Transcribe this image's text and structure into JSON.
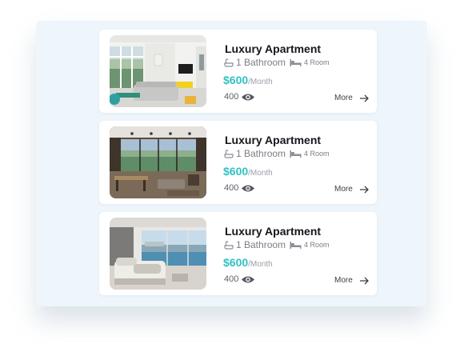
{
  "listings": [
    {
      "title": "Luxury Apartment",
      "bathrooms_label": "1 Bathroom",
      "rooms_label": "4 Room",
      "price": "$600",
      "price_unit": "/Month",
      "views": "400",
      "more_label": "More",
      "image_icon": "living-room-photo"
    },
    {
      "title": "Luxury Apartment",
      "bathrooms_label": "1 Bathroom",
      "rooms_label": "4 Room",
      "price": "$600",
      "price_unit": "/Month",
      "views": "400",
      "more_label": "More",
      "image_icon": "dining-terrace-photo"
    },
    {
      "title": "Luxury Apartment",
      "bathrooms_label": "1 Bathroom",
      "rooms_label": "4 Room",
      "price": "$600",
      "price_unit": "/Month",
      "views": "400",
      "more_label": "More",
      "image_icon": "bedroom-view-photo"
    }
  ],
  "colors": {
    "accent": "#2fc2c3",
    "panel_bg": "#eef5fb",
    "card_bg": "#ffffff",
    "title": "#14171c",
    "muted": "#7a7e86"
  },
  "icons": {
    "bath": "bathtub-icon",
    "bed": "bed-icon",
    "views": "eye-icon",
    "more": "arrow-right-icon"
  }
}
